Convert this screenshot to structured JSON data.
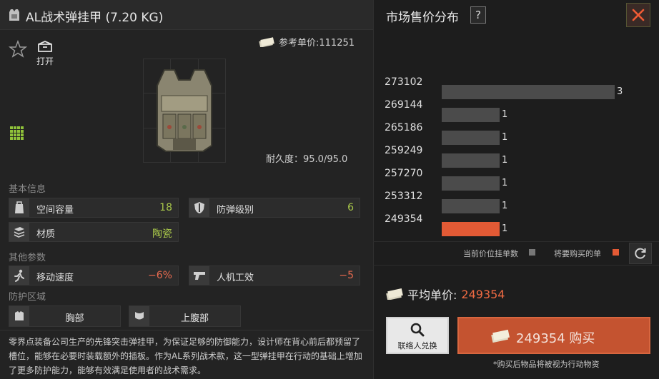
{
  "item": {
    "title": "AL战术弹挂甲 (7.20 KG)",
    "open_label": "打开",
    "ref_price_label": "参考单价:111251",
    "durability": "耐久度：95.0/95.0"
  },
  "sections": {
    "basic": "基本信息",
    "other": "其他参数",
    "protect": "防护区域"
  },
  "basic_stats": [
    {
      "label": "空间容量",
      "value": "18"
    },
    {
      "label": "防弹级别",
      "value": "6"
    },
    {
      "label": "材质",
      "value": "陶瓷"
    }
  ],
  "other_stats": [
    {
      "label": "移动速度",
      "value": "−6%"
    },
    {
      "label": "人机工效",
      "value": "−5"
    }
  ],
  "zones": [
    {
      "label": "胸部"
    },
    {
      "label": "上腹部"
    }
  ],
  "description": "零界点装备公司生产的先锋突击弹挂甲，为保证足够的防御能力，设计师在背心前后都预留了槽位，能够在必要时装载额外的插板。作为AL系列战术款，这一型弹挂甲在行动的基础上增加了更多防护能力，能够有效满足使用者的战术需求。",
  "market": {
    "title": "市场售价分布",
    "help": "?",
    "legend_current": "当前价位挂单数",
    "legend_buy": "将要购买的单",
    "avg_label": "平均单价:",
    "avg_value": "249354",
    "contact_label": "联络人兑换",
    "buy_label": "249354  购买",
    "note": "*购买后物品将被视为行动物资"
  },
  "colors": {
    "accent": "#e35a35",
    "positive": "#a9c84a",
    "negative": "#e86a4f"
  },
  "chart_data": {
    "type": "bar",
    "orientation": "horizontal",
    "categories": [
      "273102",
      "269144",
      "265186",
      "259249",
      "257270",
      "253312",
      "249354"
    ],
    "values": [
      3,
      1,
      1,
      1,
      1,
      1,
      1
    ],
    "highlighted": "249354",
    "xlabel": "",
    "ylabel": ""
  }
}
